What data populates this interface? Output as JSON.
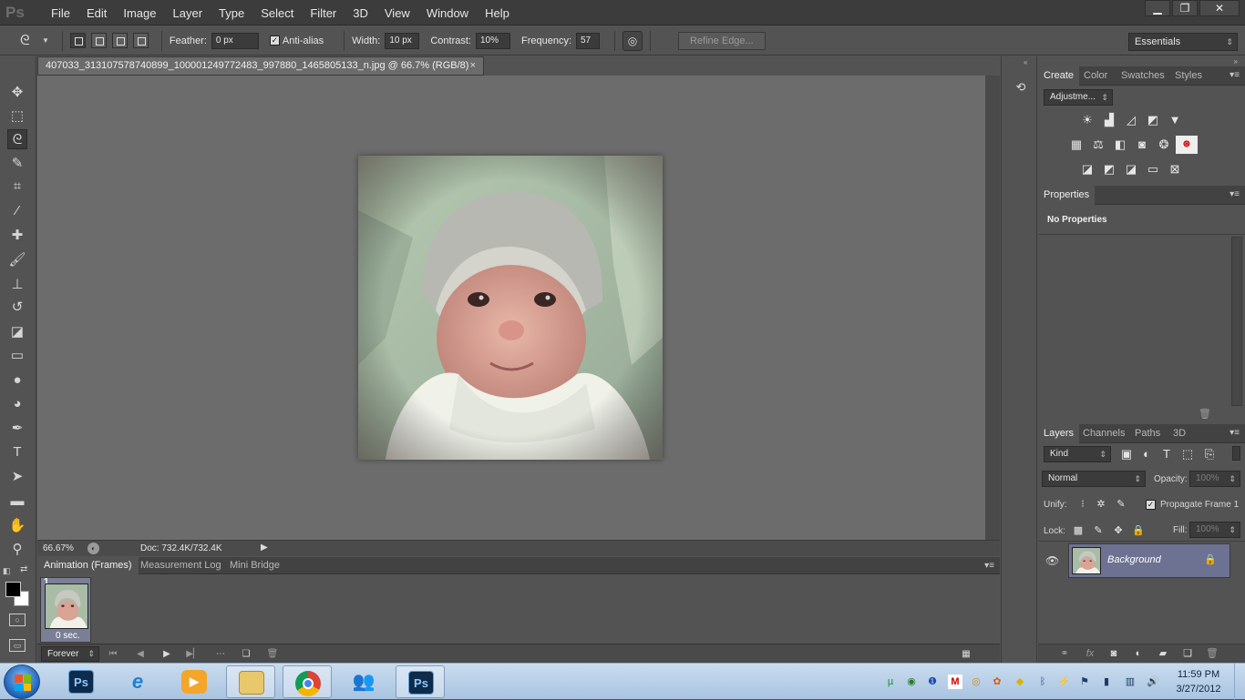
{
  "app": {
    "logo": "Ps"
  },
  "menubar": {
    "items": [
      "File",
      "Edit",
      "Image",
      "Layer",
      "Type",
      "Select",
      "Filter",
      "3D",
      "View",
      "Window",
      "Help"
    ]
  },
  "window_controls": {
    "minimize": "▁",
    "maximize": "❐",
    "close": "✕"
  },
  "options": {
    "feather_label": "Feather:",
    "feather_value": "0 px",
    "antialias_label": "Anti-alias",
    "antialias_checked": true,
    "width_label": "Width:",
    "width_value": "10 px",
    "contrast_label": "Contrast:",
    "contrast_value": "10%",
    "frequency_label": "Frequency:",
    "frequency_value": "57",
    "refine_label": "Refine Edge...",
    "workspace": "Essentials"
  },
  "document": {
    "tab_title": "407033_313107578740899_100001249772483_997880_1465805133_n.jpg @ 66.7% (RGB/8)",
    "close": "×",
    "zoom": "66.67%",
    "doc_size": "Doc: 732.4K/732.4K"
  },
  "tools": [
    {
      "name": "move-tool-icon",
      "glyph": "✥"
    },
    {
      "name": "marquee-tool-icon",
      "glyph": "⬚"
    },
    {
      "name": "lasso-tool-icon",
      "glyph": "ᘓ",
      "active": true
    },
    {
      "name": "quick-selection-tool-icon",
      "glyph": "✎"
    },
    {
      "name": "crop-tool-icon",
      "glyph": "⌗"
    },
    {
      "name": "eyedropper-tool-icon",
      "glyph": "⁄"
    },
    {
      "name": "healing-brush-tool-icon",
      "glyph": "✚"
    },
    {
      "name": "brush-tool-icon",
      "glyph": "🖌"
    },
    {
      "name": "clone-stamp-tool-icon",
      "glyph": "⊥"
    },
    {
      "name": "history-brush-tool-icon",
      "glyph": "↺"
    },
    {
      "name": "eraser-tool-icon",
      "glyph": "◪"
    },
    {
      "name": "gradient-tool-icon",
      "glyph": "▭"
    },
    {
      "name": "blur-tool-icon",
      "glyph": "●"
    },
    {
      "name": "dodge-tool-icon",
      "glyph": "◕"
    },
    {
      "name": "pen-tool-icon",
      "glyph": "✒"
    },
    {
      "name": "type-tool-icon",
      "glyph": "T"
    },
    {
      "name": "path-selection-tool-icon",
      "glyph": "➤"
    },
    {
      "name": "rectangle-tool-icon",
      "glyph": "▬"
    },
    {
      "name": "hand-tool-icon",
      "glyph": "✋"
    },
    {
      "name": "zoom-tool-icon",
      "glyph": "⚲"
    }
  ],
  "animation": {
    "tabs": [
      "Animation (Frames)",
      "Measurement Log",
      "Mini Bridge"
    ],
    "frame_number": "1",
    "frame_duration": "0 sec.",
    "loop": "Forever"
  },
  "adjustments": {
    "tabs": [
      "Create",
      "Color",
      "Swatches",
      "Styles"
    ],
    "preset": "Adjustme..."
  },
  "properties": {
    "title": "Properties",
    "text": "No Properties"
  },
  "layers": {
    "tabs": [
      "Layers",
      "Channels",
      "Paths",
      "3D"
    ],
    "kind": "Kind",
    "blend_mode": "Normal",
    "opacity_label": "Opacity:",
    "opacity_value": "100%",
    "unify_label": "Unify:",
    "propagate_label": "Propagate Frame 1",
    "lock_label": "Lock:",
    "fill_label": "Fill:",
    "fill_value": "100%",
    "layer_name": "Background"
  },
  "taskbar": {
    "clock_time": "11:59 PM",
    "clock_date": "3/27/2012"
  },
  "colors": {
    "foreground": "#000000",
    "background": "#ffffff",
    "selected_layer": "#6d7292"
  }
}
